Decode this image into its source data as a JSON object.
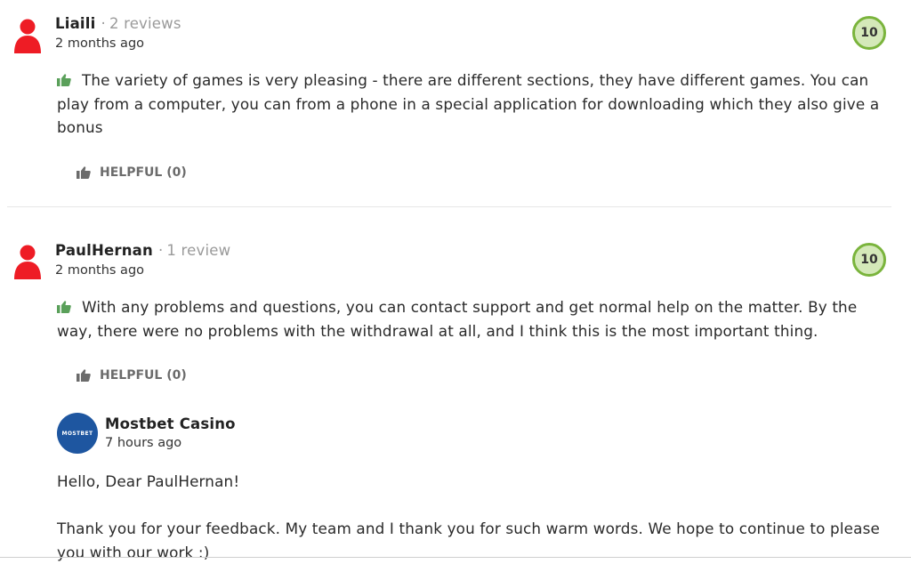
{
  "reviews": [
    {
      "username": "Liaili",
      "review_count": "2 reviews",
      "date": "2 months ago",
      "score": "10",
      "text": "The variety of games is very pleasing - there are different sections, they have different games. You can play from a computer, you can from a phone in a special application for downloading which they also give a bonus",
      "helpful_label": "HELPFUL (0)"
    },
    {
      "username": "PaulHernan",
      "review_count": "1 review",
      "date": "2 months ago",
      "score": "10",
      "text": "With any problems and questions, you can contact support and get normal help on the matter. By the way, there were no problems with the withdrawal at all, and I think this is the most important thing.",
      "helpful_label": "HELPFUL (0)"
    }
  ],
  "reply": {
    "logo_text": "MOSTBET",
    "name": "Mostbet Casino",
    "date": "7 hours ago",
    "greeting": "Hello, Dear PaulHernan!",
    "body": "Thank you for your feedback. My team and I thank you for such warm words. We hope to continue to please you with our work :)"
  },
  "colors": {
    "avatar": "#ee1c25",
    "score_fill": "#d4e9b9",
    "score_ring": "#7ab43c",
    "thumb_green": "#5aa05a",
    "brand_blue": "#1e56a0"
  },
  "icons": {
    "avatar": "user-silhouette-icon",
    "positive": "thumbs-up-icon",
    "helpful": "thumbs-up-icon"
  }
}
